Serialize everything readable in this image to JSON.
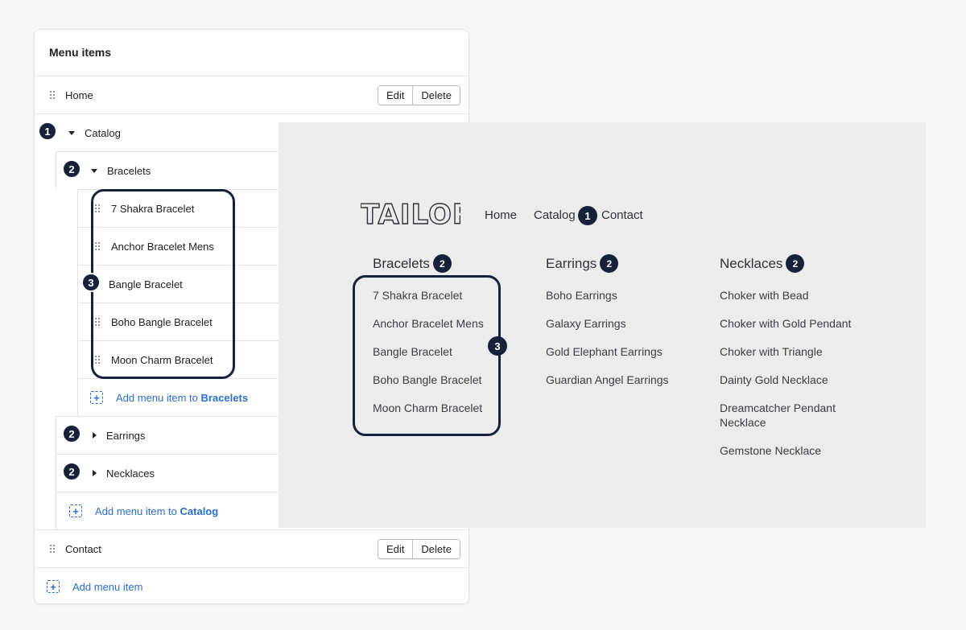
{
  "admin": {
    "title": "Menu items",
    "edit_label": "Edit",
    "delete_label": "Delete",
    "home": "Home",
    "catalog": "Catalog",
    "bracelets": "Bracelets",
    "bracelet_items": [
      "7 Shakra Bracelet",
      "Anchor Bracelet Mens",
      "Bangle Bracelet",
      "Boho Bangle Bracelet",
      "Moon Charm Bracelet"
    ],
    "add_to_bracelets_prefix": "Add menu item to",
    "add_to_bracelets_target": "Bracelets",
    "earrings": "Earrings",
    "necklaces": "Necklaces",
    "add_to_catalog_prefix": "Add menu item to",
    "add_to_catalog_target": "Catalog",
    "contact": "Contact",
    "add_menu_item": "Add menu item"
  },
  "badges": {
    "one": "1",
    "two": "2",
    "three": "3"
  },
  "preview": {
    "logo_text": "TAILOR",
    "nav": {
      "home": "Home",
      "catalog": "Catalog",
      "contact": "Contact"
    },
    "columns": [
      {
        "heading": "Bracelets",
        "items": [
          "7 Shakra Bracelet",
          "Anchor Bracelet Mens",
          "Bangle Bracelet",
          "Boho Bangle Bracelet",
          "Moon Charm Bracelet"
        ]
      },
      {
        "heading": "Earrings",
        "items": [
          "Boho Earrings",
          "Galaxy Earrings",
          "Gold Elephant Earrings",
          "Guardian Angel Earrings"
        ]
      },
      {
        "heading": "Necklaces",
        "items": [
          "Choker with Bead",
          "Choker with Gold Pendant",
          "Choker with Triangle",
          "Dainty Gold Necklace",
          "Dreamcatcher Pendant Necklace",
          "Gemstone Necklace"
        ]
      }
    ]
  },
  "colors": {
    "badge": "#16213a",
    "link": "#2c6ecb",
    "preview_bg": "#ececec"
  },
  "icons": [
    "drag-handle-icon",
    "caret-down-icon",
    "caret-right-icon",
    "add-item-icon"
  ]
}
